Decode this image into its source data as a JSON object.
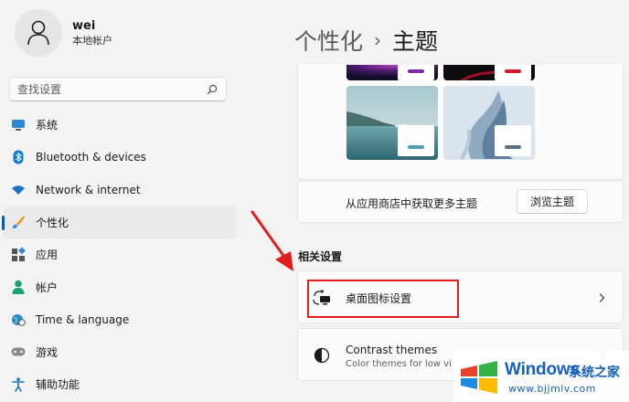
{
  "user": {
    "name": "wei",
    "account_type": "本地帐户"
  },
  "search": {
    "placeholder": "查找设置"
  },
  "nav": {
    "items": [
      {
        "label": "系统",
        "icon": "monitor-icon"
      },
      {
        "label": "Bluetooth & devices",
        "icon": "bluetooth-icon"
      },
      {
        "label": "Network & internet",
        "icon": "wifi-icon"
      },
      {
        "label": "个性化",
        "icon": "brush-icon",
        "selected": true
      },
      {
        "label": "应用",
        "icon": "apps-icon"
      },
      {
        "label": "帐户",
        "icon": "person-icon"
      },
      {
        "label": "Time & language",
        "icon": "globe-clock-icon"
      },
      {
        "label": "游戏",
        "icon": "gamepad-icon"
      },
      {
        "label": "辅助功能",
        "icon": "accessibility-icon"
      }
    ]
  },
  "breadcrumb": {
    "parent": "个性化",
    "separator": "›",
    "current": "主题"
  },
  "themes": {
    "store_text": "从应用商店中获取更多主题",
    "browse_button": "浏览主题",
    "thumbnails": [
      {
        "name": "glow-dark",
        "badge_color": "#7b2aa8"
      },
      {
        "name": "captured-motion",
        "badge_color": "#d51a2a"
      },
      {
        "name": "sunrise-lake",
        "badge_color": "#4b9fb0"
      },
      {
        "name": "flow",
        "badge_color": "#5b6f82"
      }
    ]
  },
  "related": {
    "title": "相关设置",
    "rows": [
      {
        "label": "桌面图标设置",
        "icon": "desktop-sync-icon"
      },
      {
        "label": "Contrast themes",
        "sublabel": "Color themes for low vi",
        "icon": "contrast-icon"
      }
    ]
  },
  "watermark": {
    "brand": "Windows",
    "cn": "系统之家",
    "url": "www.bjjmlv.com"
  },
  "colors": {
    "accent": "#005fb8",
    "annotation": "#e01e1e",
    "watermark": "#1560bd"
  }
}
